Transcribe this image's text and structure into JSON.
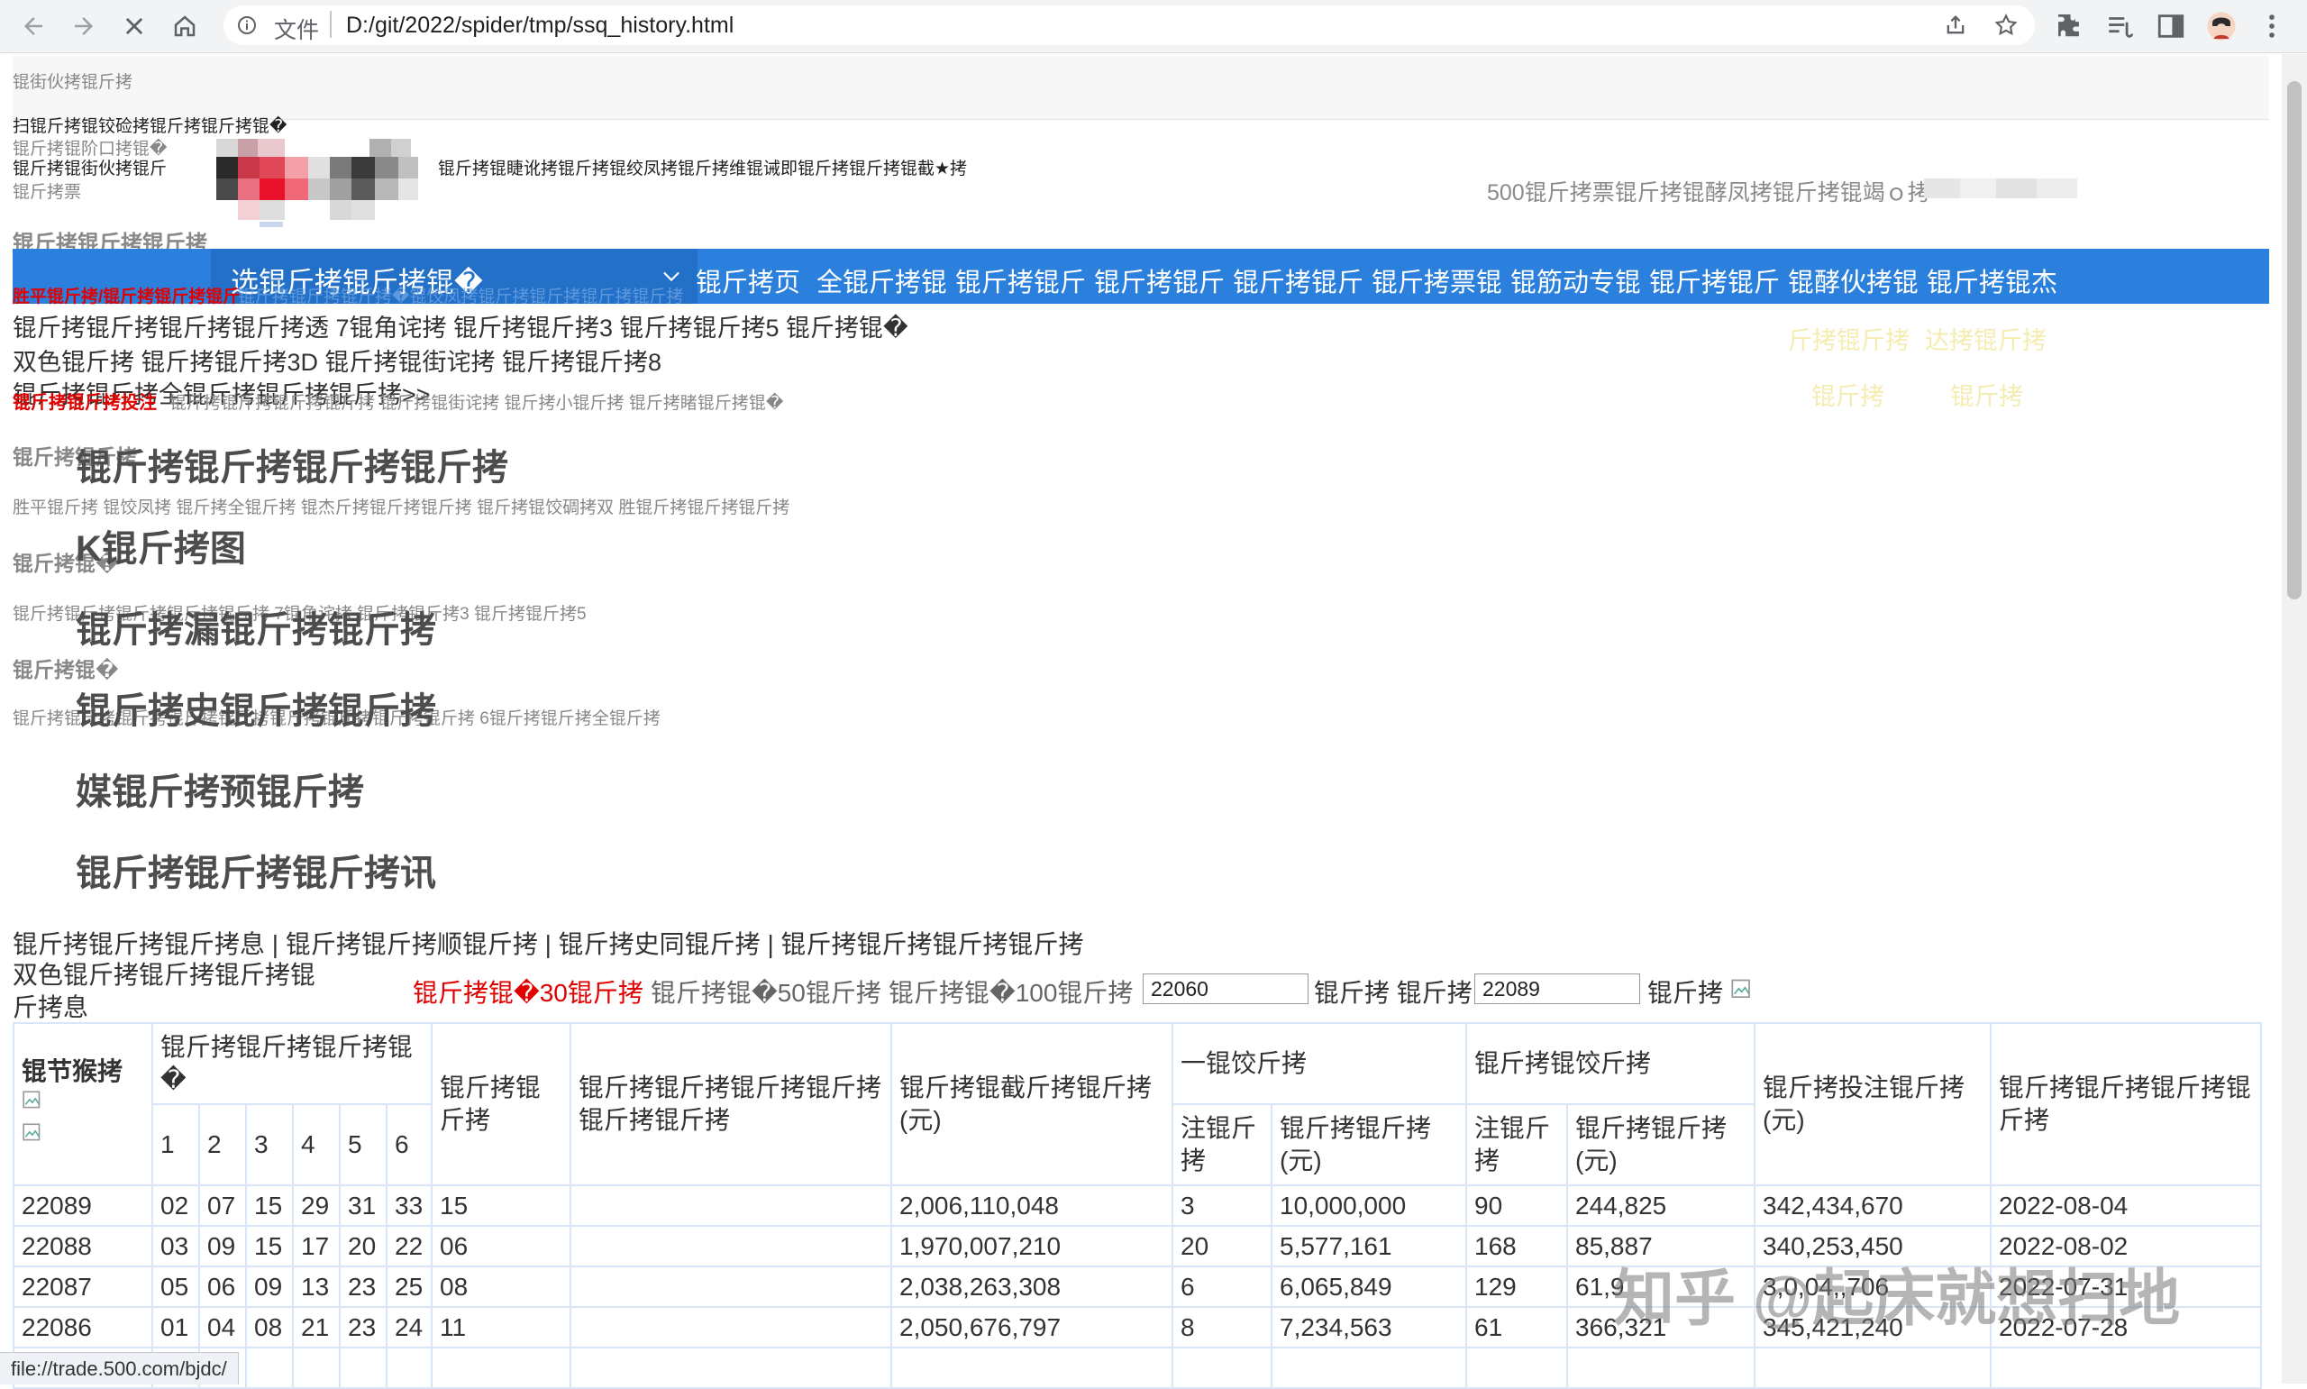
{
  "browser": {
    "scheme_label": "文件",
    "url": "D:/git/2022/spider/tmp/ssq_history.html"
  },
  "top": {
    "line1": "锟街伙拷锟斤拷",
    "line2": "扫锟斤拷锟铰硷拷锟斤拷锟斤拷锟�",
    "line3a": "锟斤拷锟阶口拷锟�",
    "line3b": "锟斤拷锟街伙拷锟斤",
    "line3c": "锟斤拷锟睫讹拷锟斤拷锟绞凤拷锟斤拷维锟诫即锟斤拷锟斤拷锟截★拷",
    "line4": "锟斤拷票",
    "right_promo": "500锟斤拷票锟斤拷锟酵凤拷锟斤拷锟竭ｏ拷"
  },
  "left_menu": {
    "h1": "锟斤拷锟斤拷锟斤拷",
    "red1": "胜平锟斤拷/锟斤拷锟斤拷锟斤",
    "blue_text": "锟斤拷锟斤拷锟斤拷�锟饺凤拷锟斤拷锟斤拷锟斤拷锟斤拷",
    "line_a": "锟斤拷锟斤拷锟斤拷锟斤拷透 7锟角诧拷 锟斤拷锟斤拷3 锟斤拷锟斤拷5 锟斤拷锟�",
    "line_b": "双色锟斤拷 锟斤拷锟斤拷3D 锟斤拷锟街诧拷 锟斤拷锟斤拷8",
    "line_c": "锟斤拷锟斤拷全锟斤拷锟斤拷锟斤拷>>",
    "red2": "锟斤拷锟斤拷投注",
    "line_d": "锟斤拷锟斤拷锟斤拷锟斤拷 锟斤拷锟街诧拷 锟斤拷小锟斤拷 锟斤拷睹锟斤拷锟�",
    "h2": "锟斤拷锟斤拷",
    "line_e": "胜平锟斤拷 锟饺凤拷 锟斤拷全锟斤拷 锟杰斤拷锟斤拷锟斤拷 锟斤拷锟饺碉拷双 胜锟斤拷锟斤拷锟斤拷",
    "h3": "锟斤拷锟�",
    "line_f": "锟斤拷锟斤拷锟斤拷锟斤拷锟斤拷 7锟角诧拷 锟斤拷锟斤拷3 锟斤拷锟斤拷5",
    "h4": "锟斤拷锟�",
    "line_g": "锟斤拷锟斤拷锟斤拷锟斤拷锟斤拷锟斤拷锟斤拷锟斤拷锟斤拷 6锟斤拷锟斤拷全锟斤拷"
  },
  "yellow_links": [
    "斤拷锟斤拷",
    "达拷锟斤拷",
    "锟斤拷",
    "锟斤拷"
  ],
  "navbar": {
    "select_label": "选锟斤拷锟斤拷锟�",
    "items": [
      "锟斤拷页",
      "全锟斤拷锟",
      "锟斤拷锟斤",
      "锟斤拷锟斤",
      "锟斤拷锟斤",
      "锟斤拷票锟",
      "锟筋动专锟",
      "锟斤拷锟斤",
      "锟酵伙拷锟",
      "锟斤拷锟杰"
    ]
  },
  "big_headings": [
    "锟斤拷锟斤拷锟斤拷锟斤拷",
    "K锟斤拷图",
    "锟斤拷漏锟斤拷锟斤拷",
    "锟斤拷史锟斤拷锟斤拷",
    "媒锟斤拷预锟斤拷",
    "锟斤拷锟斤拷锟斤拷讯"
  ],
  "breadcrumb": "锟斤拷锟斤拷锟斤拷息 | 锟斤拷锟斤拷顺锟斤拷 | 锟斤拷史同锟斤拷 | 锟斤拷锟斤拷锟斤拷锟斤拷",
  "filter": {
    "title": "双色锟斤拷锟斤拷锟斤拷锟斤拷息",
    "opt30": "锟斤拷锟�30锟斤拷",
    "opt50": "锟斤拷锟�50锟斤拷",
    "opt100": "锟斤拷锟�100锟斤拷",
    "from_value": "22060",
    "mid_label": "锟斤拷 锟斤拷",
    "to_value": "22089",
    "end_label": "锟斤拷"
  },
  "table": {
    "h_issue": "锟节猴拷",
    "h_numbers": "锟斤拷锟斤拷锟斤拷锟�",
    "h_blue": "锟斤拷锟斤拷",
    "h_happy": "锟斤拷锟斤拷锟斤拷锟斤拷锟斤拷锟斤拷",
    "h_pool": "锟斤拷锟截斤拷锟斤拷(元)",
    "h_first": "一锟饺斤拷",
    "h_second": "锟斤拷锟饺斤拷",
    "h_total": "锟斤拷投注锟斤拷(元)",
    "h_date": "锟斤拷锟斤拷锟斤拷锟斤拷",
    "h_count": "注锟斤拷",
    "h_prize": "锟斤拷锟斤拷(元)",
    "ball_nums": [
      "1",
      "2",
      "3",
      "4",
      "5",
      "6"
    ],
    "rows": [
      {
        "issue": "22089",
        "balls": [
          "02",
          "07",
          "15",
          "29",
          "31",
          "33"
        ],
        "blue": "15",
        "pool": "2,006,110,048",
        "c1": "3",
        "p1": "10,000,000",
        "c2": "90",
        "p2": "244,825",
        "total": "342,434,670",
        "date": "2022-08-04"
      },
      {
        "issue": "22088",
        "balls": [
          "03",
          "09",
          "15",
          "17",
          "20",
          "22"
        ],
        "blue": "06",
        "pool": "1,970,007,210",
        "c1": "20",
        "p1": "5,577,161",
        "c2": "168",
        "p2": "85,887",
        "total": "340,253,450",
        "date": "2022-08-02"
      },
      {
        "issue": "22087",
        "balls": [
          "05",
          "06",
          "09",
          "13",
          "23",
          "25"
        ],
        "blue": "08",
        "pool": "2,038,263,308",
        "c1": "6",
        "p1": "6,065,849",
        "c2": "129",
        "p2": "61,9",
        "total": "3,0,04,,706",
        "date": "2022-07-31"
      },
      {
        "issue": "22086",
        "balls": [
          "01",
          "04",
          "08",
          "21",
          "23",
          "24"
        ],
        "blue": "11",
        "pool": "2,050,676,797",
        "c1": "8",
        "p1": "7,234,563",
        "c2": "61",
        "p2": "366,321",
        "total": "345,421,240",
        "date": "2022-07-28"
      }
    ]
  },
  "statusbar": "file://trade.500.com/bjdc/",
  "watermark": "知乎 @起床就想扫地",
  "colors": {
    "nav_blue": "#2b7fdd",
    "red": "#e00000",
    "table_border": "#d9e6f5"
  }
}
